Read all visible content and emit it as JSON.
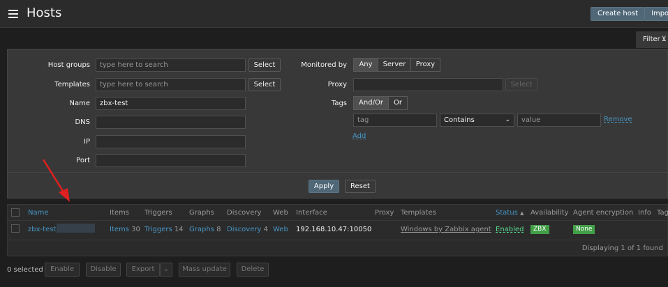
{
  "header": {
    "title": "Hosts",
    "create_host": "Create host",
    "import": "Impo"
  },
  "filter": {
    "tab_label": "Filter",
    "host_groups": {
      "label": "Host groups",
      "placeholder": "type here to search",
      "button": "Select"
    },
    "templates": {
      "label": "Templates",
      "placeholder": "type here to search",
      "button": "Select"
    },
    "name": {
      "label": "Name",
      "value": "zbx-test"
    },
    "dns": {
      "label": "DNS",
      "value": ""
    },
    "ip": {
      "label": "IP",
      "value": ""
    },
    "port": {
      "label": "Port",
      "value": ""
    },
    "monitored_by": {
      "label": "Monitored by",
      "options": [
        "Any",
        "Server",
        "Proxy"
      ],
      "selected": "Any"
    },
    "proxy": {
      "label": "Proxy",
      "value": "",
      "button": "Select"
    },
    "tags": {
      "label": "Tags",
      "options": [
        "And/Or",
        "Or"
      ],
      "selected": "And/Or",
      "tag_placeholder": "tag",
      "operator": "Contains",
      "value_placeholder": "value",
      "remove": "Remove",
      "add": "Add"
    },
    "apply": "Apply",
    "reset": "Reset"
  },
  "table": {
    "columns": [
      "Name",
      "Items",
      "Triggers",
      "Graphs",
      "Discovery",
      "Web",
      "Interface",
      "Proxy",
      "Templates",
      "Status",
      "Availability",
      "Agent encryption",
      "Info",
      "Tag"
    ],
    "sort_indicator": "▲",
    "rows": [
      {
        "name": "zbx-test.",
        "items": "Items",
        "items_count": "30",
        "triggers": "Triggers",
        "triggers_count": "14",
        "graphs": "Graphs",
        "graphs_count": "8",
        "discovery": "Discovery",
        "discovery_count": "4",
        "web": "Web",
        "interface": "192.168.10.47:10050",
        "proxy": "",
        "templates": "Windows by Zabbix agent",
        "status": "Enabled",
        "availability": "ZBX",
        "encryption": "None"
      }
    ],
    "footer": "Displaying 1 of 1 found"
  },
  "bulk": {
    "selected": "0 selected",
    "enable": "Enable",
    "disable": "Disable",
    "export": "Export",
    "mass_update": "Mass update",
    "delete": "Delete"
  },
  "colors": {
    "primary_button": "#4f6777",
    "link": "#4796c4",
    "status_green": "#429e47",
    "arrow_red": "#e02020"
  }
}
